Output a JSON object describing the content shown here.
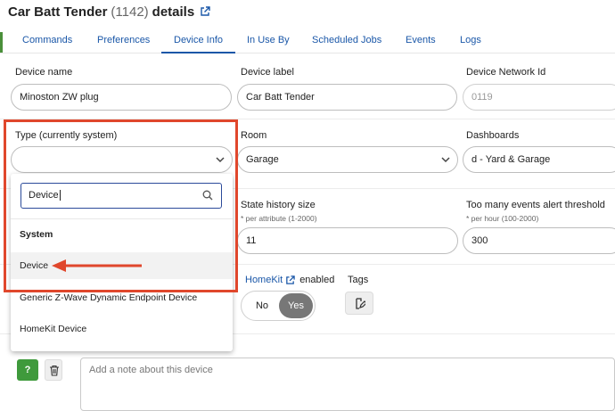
{
  "header": {
    "title_prefix": "Car Batt Tender",
    "device_id": "(1142)",
    "title_suffix": "details",
    "external_link_icon": "external-link-icon"
  },
  "tabs": [
    {
      "label": "Commands"
    },
    {
      "label": "Preferences"
    },
    {
      "label": "Device Info",
      "active": true
    },
    {
      "label": "In Use By"
    },
    {
      "label": "Scheduled Jobs"
    },
    {
      "label": "Events"
    },
    {
      "label": "Logs"
    }
  ],
  "fields": {
    "device_name": {
      "label": "Device name",
      "value": "Minoston ZW plug"
    },
    "device_label": {
      "label": "Device label",
      "value": "Car Batt Tender"
    },
    "network_id": {
      "label": "Device Network Id",
      "value": "0119"
    },
    "type": {
      "label": "Type (currently system)",
      "value": ""
    },
    "room": {
      "label": "Room",
      "value": "Garage"
    },
    "dashboards": {
      "label": "Dashboards",
      "value": "d - Yard & Garage"
    },
    "state_history": {
      "label": "State history size",
      "hint": "* per attribute (1-2000)",
      "value": "11"
    },
    "too_many_events": {
      "label": "Too many events alert threshold",
      "hint": "* per hour (100-2000)",
      "value": "300"
    },
    "homekit": {
      "link": "HomeKit",
      "suffix": "enabled",
      "off_label": "No",
      "on_label": "Yes",
      "state": "Yes"
    },
    "tags": {
      "label": "Tags"
    },
    "note": {
      "placeholder": "Add a note about this device"
    }
  },
  "dropdown": {
    "search_value": "Device",
    "group_label": "System",
    "items": [
      "Device",
      "Generic Z-Wave Dynamic Endpoint Device",
      "HomeKit Device"
    ]
  },
  "buttons": {
    "help_label": "?"
  },
  "colors": {
    "accent": "#1a57a8",
    "annotation": "#e0472c",
    "help_green": "#3f9a3c",
    "toggle_on": "#777777"
  }
}
